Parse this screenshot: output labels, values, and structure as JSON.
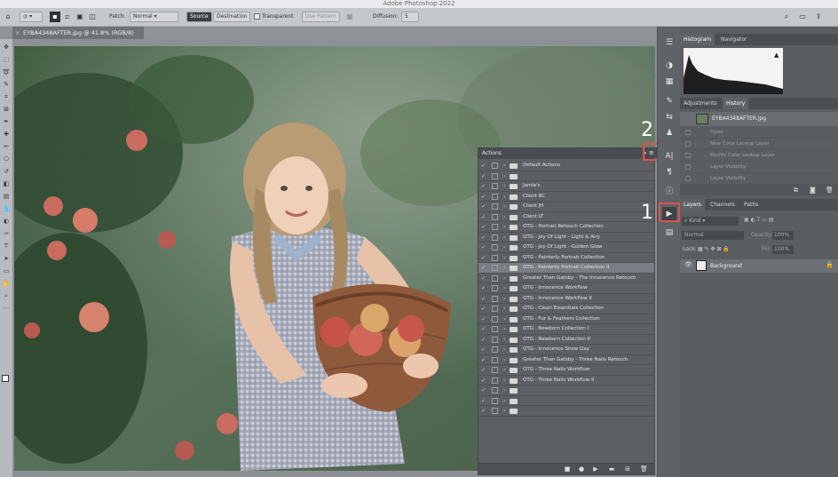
{
  "app": {
    "title": "Adobe Photoshop 2022"
  },
  "options_bar": {
    "patch_label": "Patch:",
    "patch_value": "Normal",
    "source_button": "Source",
    "destination_button": "Destination",
    "transparent_label": "Transparent",
    "use_pattern_button": "Use Pattern",
    "diffusion_label": "Diffusion:",
    "diffusion_value": "5"
  },
  "document": {
    "tab_title": "EYBA4348AFTER.jpg @ 41.8% (RGB/8)"
  },
  "right_panel": {
    "top_tabs": [
      "Histogram",
      "Navigator"
    ],
    "mid_tabs": [
      "Adjustments",
      "History"
    ],
    "history_snapshot": "EYBA4348AFTER.jpg",
    "history_items": [
      "Open",
      "New Color Lookup Layer",
      "Modify Color Lookup Layer",
      "Layer Visibility",
      "Layer Visibility"
    ],
    "layer_tabs": [
      "Layers",
      "Channels",
      "Paths"
    ],
    "kind_label": "Kind",
    "blend_mode": "Normal",
    "opacity_label": "Opacity:",
    "opacity_value": "100%",
    "lock_label": "Lock:",
    "fill_label": "Fill:",
    "fill_value": "100%",
    "layer_name": "Background"
  },
  "actions_panel": {
    "title": "Actions",
    "rows": [
      {
        "label": "Default Actions",
        "selected": false
      },
      {
        "label": "",
        "selected": false
      },
      {
        "label": "Jamie's",
        "selected": false
      },
      {
        "label": "Client BC",
        "selected": false
      },
      {
        "label": "Client JH",
        "selected": false
      },
      {
        "label": "Client LT",
        "selected": false
      },
      {
        "label": "OTG - Portrait Retouch Collection",
        "selected": false
      },
      {
        "label": "OTG - Joy Of Light - Light & Airy",
        "selected": false
      },
      {
        "label": "OTG - Joy Of Light - Golden Glow",
        "selected": false
      },
      {
        "label": "OTG - Painterly Portrait Collection",
        "selected": false
      },
      {
        "label": "OTG - Painterly Portrait Collection II",
        "selected": true
      },
      {
        "label": "Greater Than Gatsby - The Innocence Retouch",
        "selected": false
      },
      {
        "label": "OTG - Innocence Workflow",
        "selected": false
      },
      {
        "label": "OTG - Innocence Workflow II",
        "selected": false
      },
      {
        "label": "OTG - Clean Essentials Collection",
        "selected": false
      },
      {
        "label": "OTG - Fur & Feathers Collection",
        "selected": false
      },
      {
        "label": "OTG - Newborn Collection I",
        "selected": false
      },
      {
        "label": "OTG - Newborn Collection II",
        "selected": false
      },
      {
        "label": "OTG - Innocence Snow Day",
        "selected": false
      },
      {
        "label": "Greater Than Gatsby - Three Nails Retouch",
        "selected": false
      },
      {
        "label": "OTG - Three Nails Workflow",
        "selected": false
      },
      {
        "label": "OTG - Three Nails Workflow II",
        "selected": false
      },
      {
        "label": "",
        "selected": false
      },
      {
        "label": "",
        "selected": false
      },
      {
        "label": "",
        "selected": false
      }
    ]
  },
  "callouts": {
    "one": "1",
    "two": "2"
  },
  "colors": {
    "callout": "#d9534f",
    "panel_bg": "#5a5d62",
    "selected_row": "#7a7e84"
  }
}
